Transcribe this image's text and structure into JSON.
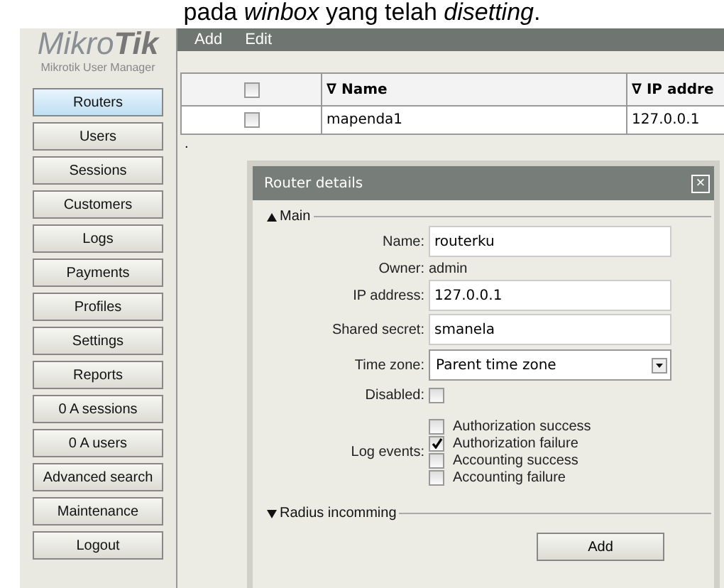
{
  "caption": "pada *winbox* yang telah *disetting*.",
  "logo": {
    "brand_light": "Mikro",
    "brand_bold": "Tik",
    "subtitle": "Mikrotik User Manager"
  },
  "sidebar": {
    "items": [
      {
        "label": "Routers",
        "selected": true
      },
      {
        "label": "Users",
        "selected": false
      },
      {
        "label": "Sessions",
        "selected": false
      },
      {
        "label": "Customers",
        "selected": false
      },
      {
        "label": "Logs",
        "selected": false
      },
      {
        "label": "Payments",
        "selected": false
      },
      {
        "label": "Profiles",
        "selected": false
      },
      {
        "label": "Settings",
        "selected": false
      },
      {
        "label": "Reports",
        "selected": false
      },
      {
        "label": "0 A sessions",
        "selected": false
      },
      {
        "label": "0 A users",
        "selected": false
      },
      {
        "label": "Advanced search",
        "selected": false
      },
      {
        "label": "Maintenance",
        "selected": false
      },
      {
        "label": "Logout",
        "selected": false
      }
    ]
  },
  "toolbar": [
    "Add",
    "Edit"
  ],
  "table": {
    "columns": [
      "∇ Name",
      "∇ IP addre"
    ],
    "header_checked": false,
    "rows": [
      {
        "checked": false,
        "cells": [
          "mapenda1",
          "127.0.0.1"
        ]
      }
    ]
  },
  "stray_mark": ".",
  "dialog": {
    "title": "Router details",
    "close": "×",
    "sections": [
      {
        "title": "Main",
        "expanded": true
      },
      {
        "title": "Radius incomming",
        "expanded": false
      }
    ],
    "fields": [
      {
        "kind": "input",
        "label": "Name:",
        "value": "routerku"
      },
      {
        "kind": "text",
        "label": "Owner:",
        "value": "admin"
      },
      {
        "kind": "input",
        "label": "IP address:",
        "value": "127.0.0.1"
      },
      {
        "kind": "input",
        "label": "Shared secret:",
        "value": "smanela"
      },
      {
        "kind": "select",
        "label": "Time zone:",
        "value": "Parent time zone"
      },
      {
        "kind": "checkbox",
        "label": "Disabled:",
        "checked": false
      }
    ],
    "log_events": {
      "label": "Log events:",
      "options": [
        {
          "label": "Authorization success",
          "checked": false
        },
        {
          "label": "Authorization failure",
          "checked": true
        },
        {
          "label": "Accounting success",
          "checked": false
        },
        {
          "label": "Accounting failure",
          "checked": false
        }
      ]
    },
    "button": "Add"
  }
}
